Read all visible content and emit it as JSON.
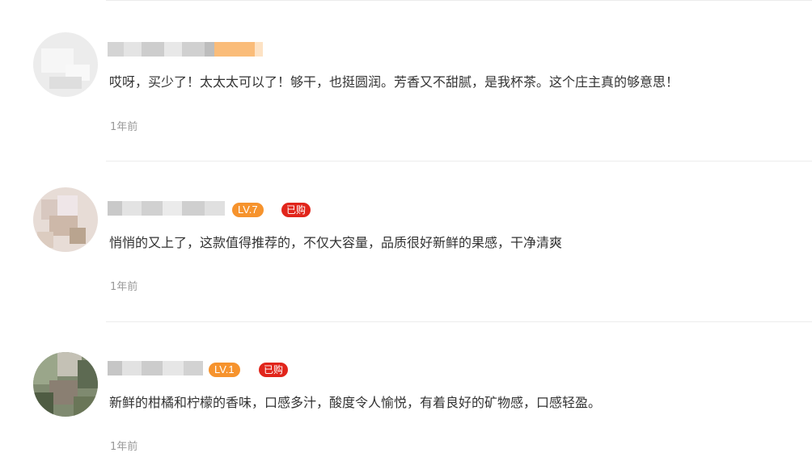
{
  "reviews": [
    {
      "comment": "哎呀，买少了！太太太可以了！够干，也挺圆润。芳香又不甜腻，是我杯茶。这个庄主真的够意思！",
      "time": "1年前"
    },
    {
      "level": "LV.7",
      "bought": "已购",
      "comment": "悄悄的又上了，这款值得推荐的，不仅大容量，品质很好新鲜的果感，干净清爽",
      "time": "1年前"
    },
    {
      "level": "LV.1",
      "bought": "已购",
      "comment": "新鲜的柑橘和柠檬的香味，口感多汁，酸度令人愉悦，有着良好的矿物感，口感轻盈。",
      "time": "1年前"
    }
  ],
  "colors": {
    "level_badge": "#f6932d",
    "bought_badge": "#e1251b",
    "comment_text": "#333333",
    "time_text": "#999999",
    "divider": "#ececec"
  }
}
